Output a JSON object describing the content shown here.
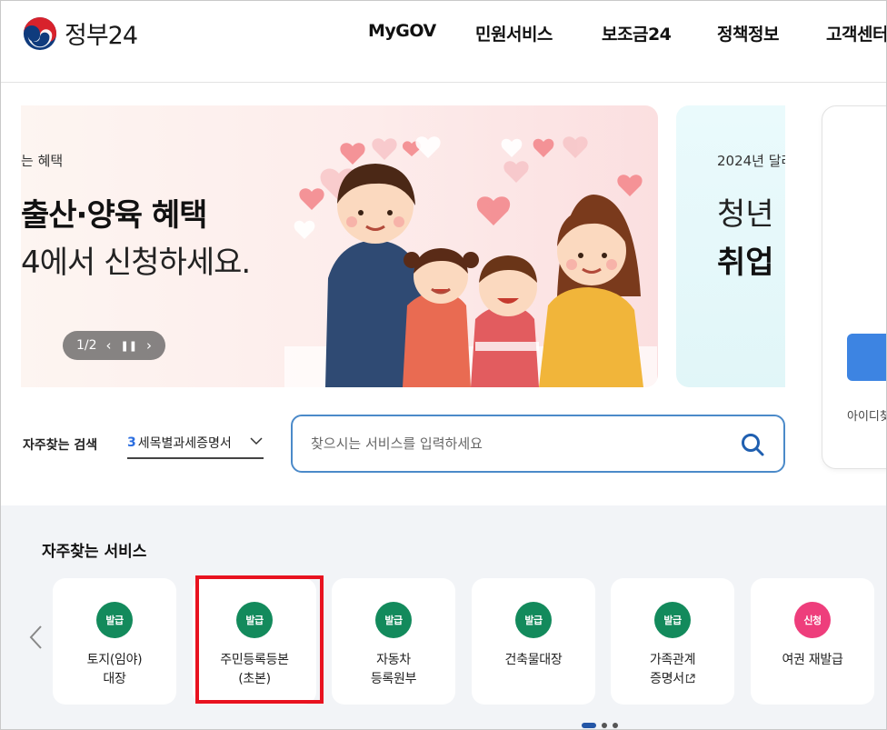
{
  "header": {
    "logo_text": "정부24",
    "nav": [
      "MyGOV",
      "민원서비스",
      "보조금24",
      "정책정보",
      "고객센터"
    ]
  },
  "banner1": {
    "kicker": "는 혜택",
    "title": "출산·양육 혜택",
    "subtitle": "4에서 신청하세요.",
    "pager": "1/2"
  },
  "banner2": {
    "kicker": "2024년 달라",
    "line1": "청년",
    "line2": "취업"
  },
  "login_card": {
    "find_text": "아이디찾"
  },
  "search": {
    "freq_label": "자주찾는 검색",
    "keyword_rank": "3",
    "keyword_text": "세목별과세증명서",
    "placeholder": "찾으시는 서비스를 입력하세요"
  },
  "services": {
    "title": "자주찾는 서비스",
    "items": [
      {
        "badge": "발급",
        "label": "토지(임야)\n대장",
        "badge_color": "#138a5c"
      },
      {
        "badge": "발급",
        "label": "주민등록등본\n(초본)",
        "badge_color": "#138a5c"
      },
      {
        "badge": "발급",
        "label": "자동차\n등록원부",
        "badge_color": "#138a5c"
      },
      {
        "badge": "발급",
        "label": "건축물대장",
        "badge_color": "#138a5c"
      },
      {
        "badge": "발급",
        "label": "가족관계\n증명서",
        "badge_color": "#138a5c"
      },
      {
        "badge": "신청",
        "label": "여권 재발급",
        "badge_color": "#ee3e7c"
      }
    ],
    "highlight_color": "#e8121f"
  },
  "icons": [
    "taegeuk-logo-icon",
    "pause-icon",
    "chevron-left-icon",
    "chevron-right-icon",
    "chevron-down-icon",
    "search-icon",
    "external-link-icon"
  ]
}
